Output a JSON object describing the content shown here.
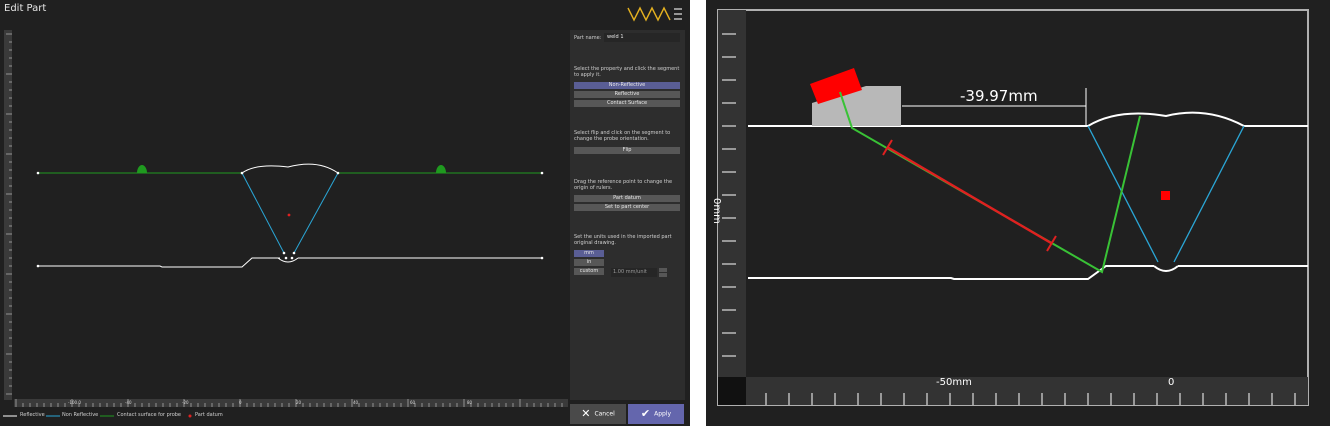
{
  "window": {
    "title": "Edit Part",
    "logo": "wave-logo-icon"
  },
  "properties_panel": {
    "part_name_label": "Part name:",
    "part_name_value": "weld 1",
    "property_instruction": "Select the property and click the segment to apply it.",
    "property_options": [
      {
        "label": "Non-Reflective",
        "selected": true
      },
      {
        "label": "Reflective",
        "selected": false
      },
      {
        "label": "Contact Surface",
        "selected": false
      }
    ],
    "flip_instruction": "Select flip and click on the segment to change the probe orientation.",
    "flip_label": "Flip",
    "origin_instruction": "Drag the reference point to change the origin of rulers.",
    "origin_buttons": [
      "Part datum",
      "Set to part center"
    ],
    "units_instruction": "Set the units used in the imported part original drawing.",
    "unit_options": [
      {
        "label": "mm",
        "selected": true
      },
      {
        "label": "in",
        "selected": false
      },
      {
        "label": "custom",
        "selected": false
      }
    ],
    "custom_units_value": "1.00 mm/unit"
  },
  "actions": {
    "cancel_label": "Cancel",
    "apply_label": "Apply"
  },
  "legend": [
    {
      "label": "Reflective",
      "color": "#ffffff"
    },
    {
      "label": "Non Reflective",
      "color": "#2aa6d6"
    },
    {
      "label": "Contact surface for probe",
      "color": "#1f9a1f"
    },
    {
      "label": "Part datum",
      "color": "#e02020"
    }
  ],
  "ruler": {
    "ticks": [
      "-100.0",
      "-40",
      "-20",
      "0",
      "20",
      "40",
      "60",
      "80"
    ]
  },
  "zoom_view": {
    "distance_label": "-39.97mm",
    "y_axis_label": "0mm",
    "x_tick_labels": [
      "-50mm",
      "0"
    ],
    "colors": {
      "beam": "#e02020",
      "probe": "#ff0000",
      "path": "#39c236",
      "boundary": "#2aa6d6"
    }
  }
}
